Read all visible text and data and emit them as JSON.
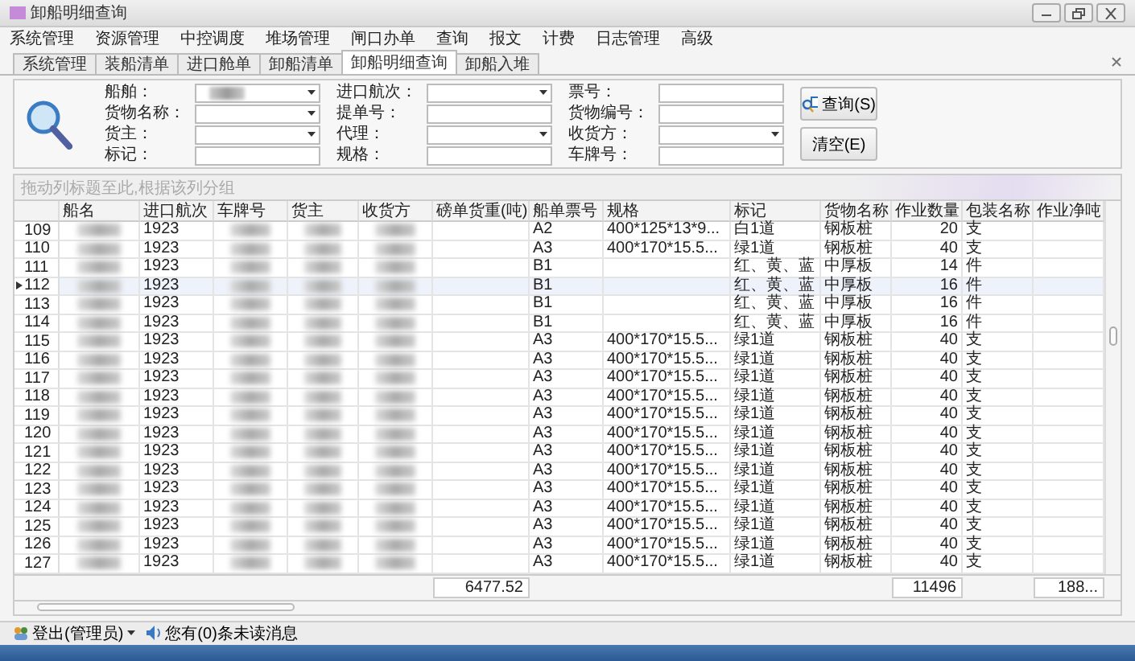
{
  "window": {
    "title": "卸船明细查询"
  },
  "menu": [
    "系统管理",
    "资源管理",
    "中控调度",
    "堆场管理",
    "闸口办单",
    "查询",
    "报文",
    "计费",
    "日志管理",
    "高级"
  ],
  "tabs": [
    {
      "label": "系统管理",
      "selected": false
    },
    {
      "label": "装船清单",
      "selected": false
    },
    {
      "label": "进口舱单",
      "selected": false
    },
    {
      "label": "卸船清单",
      "selected": false
    },
    {
      "label": "卸船明细查询",
      "selected": true
    },
    {
      "label": "卸船入堆",
      "selected": false
    }
  ],
  "search": {
    "fields": [
      {
        "label": "船舶：",
        "kind": "combo",
        "redacted": true
      },
      {
        "label": "进口航次：",
        "kind": "combo"
      },
      {
        "label": "票号：",
        "kind": "text"
      },
      {
        "label": "货物名称：",
        "kind": "combo"
      },
      {
        "label": "提单号：",
        "kind": "text"
      },
      {
        "label": "货物编号：",
        "kind": "text"
      },
      {
        "label": "货主：",
        "kind": "combo"
      },
      {
        "label": "代理：",
        "kind": "combo"
      },
      {
        "label": "收货方：",
        "kind": "combo"
      },
      {
        "label": "标记：",
        "kind": "text"
      },
      {
        "label": "规格：",
        "kind": "text"
      },
      {
        "label": "车牌号：",
        "kind": "text"
      }
    ],
    "buttons": [
      "查询(S)",
      "清空(E)"
    ]
  },
  "group_hint": "拖动列标题至此,根据该列分组",
  "table": {
    "columns": [
      {
        "label": "船名",
        "kind": "blurred"
      },
      {
        "label": "进口航次",
        "kind": "text"
      },
      {
        "label": "车牌号",
        "kind": "blurred"
      },
      {
        "label": "货主",
        "kind": "blurred"
      },
      {
        "label": "收货方",
        "kind": "blurred"
      },
      {
        "label": "磅单货重(吨)",
        "kind": "text",
        "total": "6477.52"
      },
      {
        "label": "船单票号",
        "kind": "text"
      },
      {
        "label": "规格",
        "kind": "text"
      },
      {
        "label": "标记",
        "kind": "text"
      },
      {
        "label": "货物名称",
        "kind": "text"
      },
      {
        "label": "作业数量",
        "kind": "number",
        "total": "11496"
      },
      {
        "label": "包装名称",
        "kind": "text"
      },
      {
        "label": "作业净吨",
        "kind": "text",
        "total": "188..."
      }
    ],
    "rows": [
      {
        "no": "109",
        "selected": false,
        "cells": [
          null,
          "1923",
          null,
          null,
          null,
          null,
          "A2",
          "400*125*13*9...",
          "白1道",
          "钢板桩",
          "20",
          "支",
          null
        ]
      },
      {
        "no": "110",
        "selected": false,
        "cells": [
          null,
          "1923",
          null,
          null,
          null,
          null,
          "A3",
          "400*170*15.5...",
          "绿1道",
          "钢板桩",
          "40",
          "支",
          null
        ]
      },
      {
        "no": "111",
        "selected": false,
        "cells": [
          null,
          "1923",
          null,
          null,
          null,
          null,
          "B1",
          null,
          "红、黄、蓝",
          "中厚板",
          "14",
          "件",
          null
        ]
      },
      {
        "no": "112",
        "selected": true,
        "cells": [
          null,
          "1923",
          null,
          null,
          null,
          null,
          "B1",
          null,
          "红、黄、蓝",
          "中厚板",
          "16",
          "件",
          null
        ]
      },
      {
        "no": "113",
        "selected": false,
        "cells": [
          null,
          "1923",
          null,
          null,
          null,
          null,
          "B1",
          null,
          "红、黄、蓝",
          "中厚板",
          "16",
          "件",
          null
        ]
      },
      {
        "no": "114",
        "selected": false,
        "cells": [
          null,
          "1923",
          null,
          null,
          null,
          null,
          "B1",
          null,
          "红、黄、蓝",
          "中厚板",
          "16",
          "件",
          null
        ]
      },
      {
        "no": "115",
        "selected": false,
        "cells": [
          null,
          "1923",
          null,
          null,
          null,
          null,
          "A3",
          "400*170*15.5...",
          "绿1道",
          "钢板桩",
          "40",
          "支",
          null
        ]
      },
      {
        "no": "116",
        "selected": false,
        "cells": [
          null,
          "1923",
          null,
          null,
          null,
          null,
          "A3",
          "400*170*15.5...",
          "绿1道",
          "钢板桩",
          "40",
          "支",
          null
        ]
      },
      {
        "no": "117",
        "selected": false,
        "cells": [
          null,
          "1923",
          null,
          null,
          null,
          null,
          "A3",
          "400*170*15.5...",
          "绿1道",
          "钢板桩",
          "40",
          "支",
          null
        ]
      },
      {
        "no": "118",
        "selected": false,
        "cells": [
          null,
          "1923",
          null,
          null,
          null,
          null,
          "A3",
          "400*170*15.5...",
          "绿1道",
          "钢板桩",
          "40",
          "支",
          null
        ]
      },
      {
        "no": "119",
        "selected": false,
        "cells": [
          null,
          "1923",
          null,
          null,
          null,
          null,
          "A3",
          "400*170*15.5...",
          "绿1道",
          "钢板桩",
          "40",
          "支",
          null
        ]
      },
      {
        "no": "120",
        "selected": false,
        "cells": [
          null,
          "1923",
          null,
          null,
          null,
          null,
          "A3",
          "400*170*15.5...",
          "绿1道",
          "钢板桩",
          "40",
          "支",
          null
        ]
      },
      {
        "no": "121",
        "selected": false,
        "cells": [
          null,
          "1923",
          null,
          null,
          null,
          null,
          "A3",
          "400*170*15.5...",
          "绿1道",
          "钢板桩",
          "40",
          "支",
          null
        ]
      },
      {
        "no": "122",
        "selected": false,
        "cells": [
          null,
          "1923",
          null,
          null,
          null,
          null,
          "A3",
          "400*170*15.5...",
          "绿1道",
          "钢板桩",
          "40",
          "支",
          null
        ]
      },
      {
        "no": "123",
        "selected": false,
        "cells": [
          null,
          "1923",
          null,
          null,
          null,
          null,
          "A3",
          "400*170*15.5...",
          "绿1道",
          "钢板桩",
          "40",
          "支",
          null
        ]
      },
      {
        "no": "124",
        "selected": false,
        "cells": [
          null,
          "1923",
          null,
          null,
          null,
          null,
          "A3",
          "400*170*15.5...",
          "绿1道",
          "钢板桩",
          "40",
          "支",
          null
        ]
      },
      {
        "no": "125",
        "selected": false,
        "cells": [
          null,
          "1923",
          null,
          null,
          null,
          null,
          "A3",
          "400*170*15.5...",
          "绿1道",
          "钢板桩",
          "40",
          "支",
          null
        ]
      },
      {
        "no": "126",
        "selected": false,
        "cells": [
          null,
          "1923",
          null,
          null,
          null,
          null,
          "A3",
          "400*170*15.5...",
          "绿1道",
          "钢板桩",
          "40",
          "支",
          null
        ]
      },
      {
        "no": "127",
        "selected": false,
        "cells": [
          null,
          "1923",
          null,
          null,
          null,
          null,
          "A3",
          "400*170*15.5...",
          "绿1道",
          "钢板桩",
          "40",
          "支",
          null
        ]
      }
    ]
  },
  "status_bar": {
    "logout": "登出(管理员)",
    "messages": "您有(0)条未读消息"
  }
}
